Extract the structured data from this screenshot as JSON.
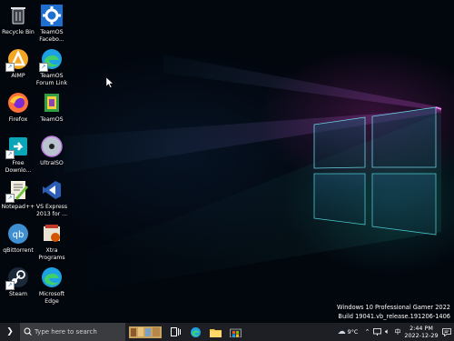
{
  "desktop_icons": [
    {
      "id": "recycle-bin",
      "label": "Recycle Bin"
    },
    {
      "id": "teamos-facebook",
      "label": "TeamOS Facebo..."
    },
    {
      "id": "aimp",
      "label": "AIMP"
    },
    {
      "id": "teamos-forum",
      "label": "TeamOS Forum Link"
    },
    {
      "id": "firefox",
      "label": "Firefox"
    },
    {
      "id": "teamos",
      "label": "TeamOS"
    },
    {
      "id": "free-download",
      "label": "Free Downlo..."
    },
    {
      "id": "ultraiso",
      "label": "UltraISO"
    },
    {
      "id": "notepadpp",
      "label": "Notepad++"
    },
    {
      "id": "vs-express",
      "label": "VS Express 2013 for ..."
    },
    {
      "id": "qbittorrent",
      "label": "qBittorrent"
    },
    {
      "id": "xtra-programs",
      "label": "Xtra Programs"
    },
    {
      "id": "steam",
      "label": "Steam"
    },
    {
      "id": "microsoft-edge",
      "label": "Microsoft Edge"
    }
  ],
  "watermark": {
    "line1": "Windows 10 Professional Gamer 2022",
    "line2": "Build 19041.vb_release.191206-1406"
  },
  "taskbar": {
    "search_placeholder": "Type here to search",
    "weather": "9°C",
    "time": "2:44 PM",
    "date": "2022-12-29"
  },
  "colors": {
    "taskbar": "#1d1f24",
    "search_box": "#3a3c40",
    "accent": "#76b9ed"
  }
}
